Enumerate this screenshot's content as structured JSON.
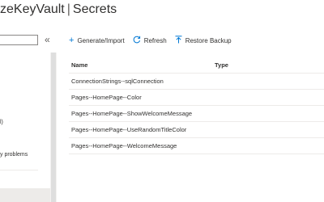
{
  "header": {
    "vault_name": "zeKeyVault",
    "separator": "|",
    "section": "Secrets"
  },
  "sidebar": {
    "collapse_glyph": "«",
    "fragments": [
      "l)",
      "y problems"
    ]
  },
  "toolbar": {
    "generate_label": "Generate/Import",
    "refresh_label": "Refresh",
    "restore_label": "Restore Backup"
  },
  "grid": {
    "columns": [
      "Name",
      "Type"
    ],
    "rows": [
      {
        "name": "ConnectionStrings--sqlConnection",
        "type": ""
      },
      {
        "name": "Pages--HomePage--Color",
        "type": ""
      },
      {
        "name": "Pages--HomePage--ShowWelcomeMessage",
        "type": ""
      },
      {
        "name": "Pages--HomePage--UseRandomTitleColor",
        "type": ""
      },
      {
        "name": "Pages--HomePage--WelcomeMessage",
        "type": ""
      }
    ]
  }
}
